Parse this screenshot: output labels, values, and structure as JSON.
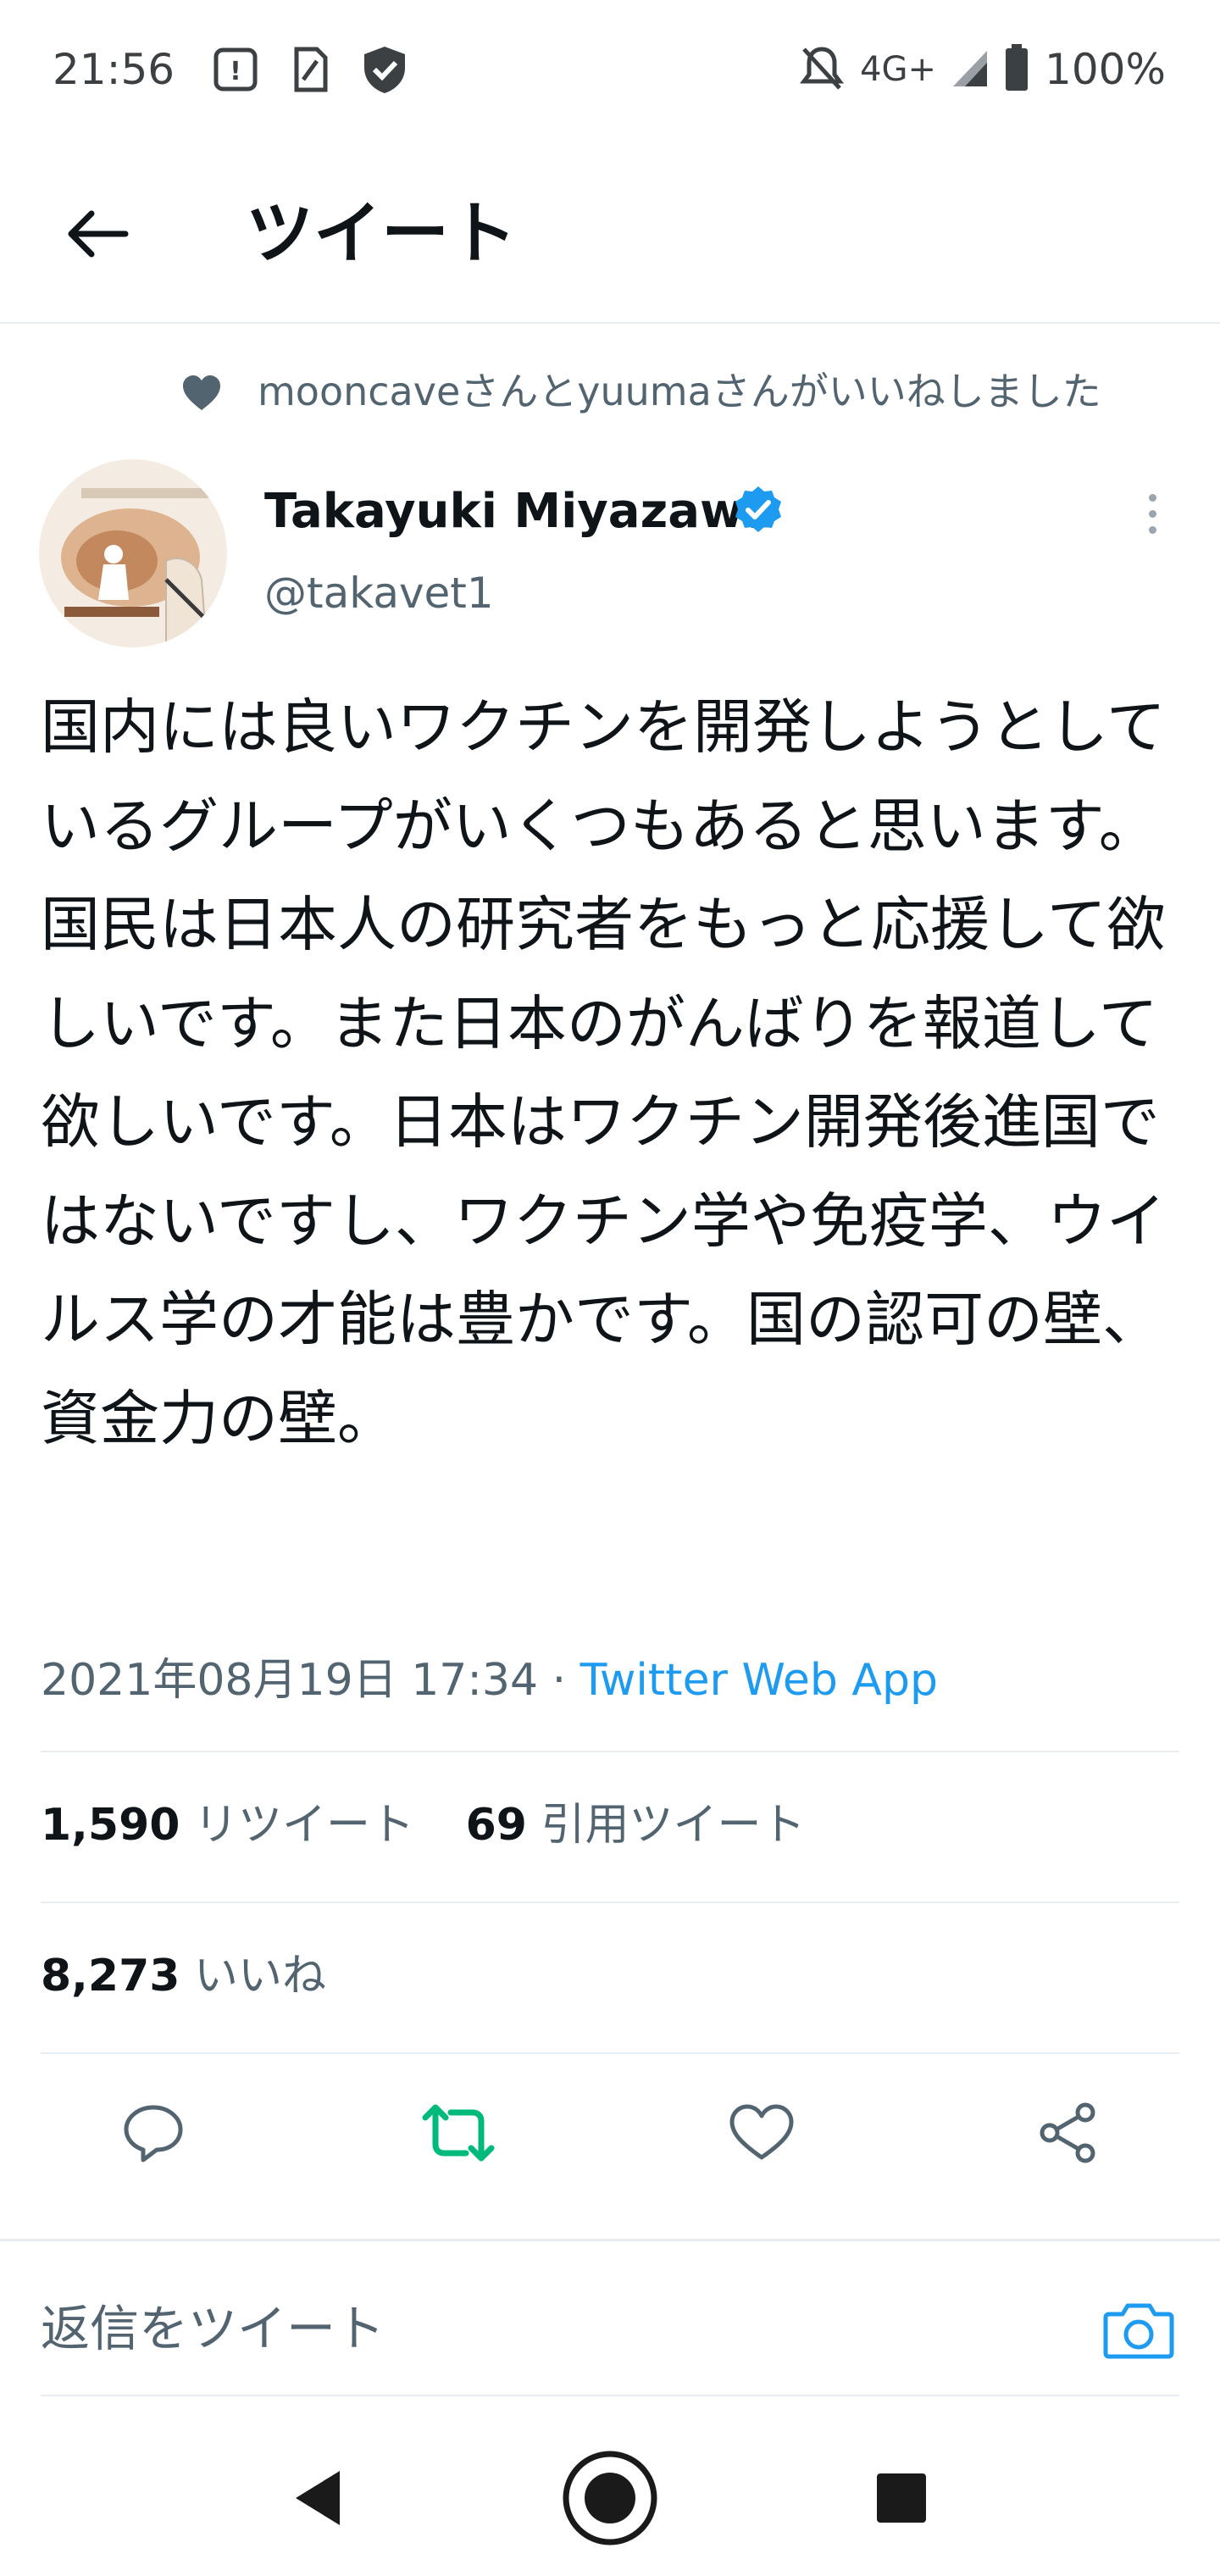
{
  "status_bar": {
    "time": "21:56",
    "network": "4G+",
    "battery": "100%",
    "icons": [
      "notification-icon",
      "sim-icon",
      "shield-icon",
      "mute-icon",
      "signal-icon",
      "battery-icon"
    ]
  },
  "header": {
    "title": "ツイート",
    "back_icon": "arrow-left-icon"
  },
  "social_context": {
    "text": "mooncaveさんとyuumaさんがいいねしました",
    "icon": "heart-filled-icon"
  },
  "author": {
    "name": "Takayuki Miyazawa",
    "handle": "@takavet1",
    "verified": true
  },
  "tweet": {
    "text": "国内には良いワクチンを開発しようとしているグループがいくつもあると思います。国民は日本人の研究者をもっと応援して欲しいです。また日本のがんばりを報道して欲しいです。日本はワクチン開発後進国ではないですし、ワクチン学や免疫学、ウイルス学の才能は豊かです。国の認可の壁、資金力の壁。",
    "timestamp": "2021年08月19日 17:34",
    "separator": " · ",
    "source": "Twitter Web App"
  },
  "stats": {
    "retweets": "1,590",
    "retweets_label": "リツイート",
    "quotes": "69",
    "quotes_label": "引用ツイート",
    "likes": "8,273",
    "likes_label": "いいね"
  },
  "actions": [
    "reply-icon",
    "retweet-icon",
    "like-icon",
    "share-icon"
  ],
  "reply": {
    "placeholder": "返信をツイート",
    "icon": "camera-icon"
  },
  "navigation": [
    "back-triangle-icon",
    "home-circle-icon",
    "recents-square-icon"
  ],
  "colors": {
    "accent": "#1d9bf0",
    "retweet_active": "#00ba7c",
    "secondary_text": "#536471",
    "divider": "#e6ecf0"
  }
}
